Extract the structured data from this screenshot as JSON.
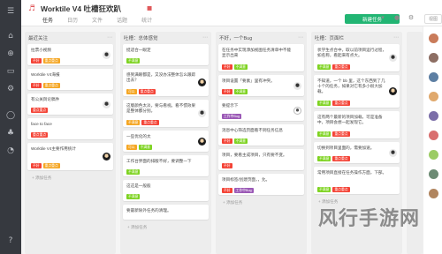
{
  "app": {
    "title": "Worktile V4 吐槽狂欢趴",
    "tabs": [
      "任务",
      "日历",
      "文件",
      "话题",
      "统计"
    ],
    "add_task_label": "新建任务",
    "more_label": "视图"
  },
  "rail_icons": [
    "menu-icon",
    "home-icon",
    "add-icon",
    "inbox-icon",
    "gear-icon",
    "chat-icon",
    "team-icon",
    "bell-icon",
    "help-icon"
  ],
  "tag_colors": {
    "red": "#f44336",
    "yellow": "#f5a623",
    "green": "#7ed321",
    "blue": "#4a90e2",
    "purple": "#9b59b6"
  },
  "columns": [
    {
      "title": "最近关注",
      "add_label": "+ 添加任务",
      "cards": [
        {
          "text": "拉票小视频",
          "tags": [
            {
              "label": "不好",
              "color": "red"
            },
            {
              "label": "重点重点",
              "color": "yellow"
            }
          ],
          "avatar": "a1"
        },
        {
          "text": "Worktile V4海报",
          "tags": [
            {
              "label": "不好",
              "color": "red"
            },
            {
              "label": "重点重点",
              "color": "yellow"
            }
          ],
          "avatar": ""
        },
        {
          "text": "有公关舆论稿件",
          "tags": [
            {
              "label": "重点重点",
              "color": "red"
            }
          ],
          "avatar": "a1"
        },
        {
          "text": "face to face",
          "tags": [
            {
              "label": "重点重点",
              "color": "red"
            }
          ],
          "avatar": ""
        },
        {
          "text": "Worktile V4主要作用统计",
          "tags": [
            {
              "label": "不好",
              "color": "red"
            },
            {
              "label": "重点重点",
              "color": "yellow"
            }
          ],
          "avatar": "a2"
        }
      ]
    },
    {
      "title": "吐槽：总体感觉",
      "add_label": "+ 添加任务",
      "cards": [
        {
          "text": "挺适合一眼定",
          "tags": [
            {
              "label": "不满意",
              "color": "green"
            }
          ],
          "avatar": ""
        },
        {
          "text": "感到满眼都是，又没办法整体怎么跟踪出去？",
          "tags": [
            {
              "label": "可以",
              "color": "yellow"
            },
            {
              "label": "重点重点",
              "color": "red"
            }
          ],
          "avatar": "a2"
        },
        {
          "text": "这版颜色太淡，要与看视。看不惯效果是整体都分别。",
          "tags": [
            {
              "label": "不满意",
              "color": "yellow"
            },
            {
              "label": "重点重点",
              "color": "red"
            }
          ],
          "avatar": "a1"
        },
        {
          "text": "一些优化的太",
          "tags": [
            {
              "label": "可以",
              "color": "yellow"
            },
            {
              "label": "不满意",
              "color": "green"
            }
          ],
          "avatar": "a2"
        },
        {
          "text": "工作台界面的排版不好，要调整一下",
          "tags": [
            {
              "label": "不满意",
              "color": "green"
            }
          ],
          "avatar": ""
        },
        {
          "text": "这这是一般般",
          "tags": [
            {
              "label": "不满意",
              "color": "green"
            }
          ],
          "avatar": ""
        },
        {
          "text": "要最新除外任务的清理。",
          "tags": [],
          "avatar": ""
        }
      ]
    },
    {
      "title": "不好，一个Bug",
      "add_label": "+ 添加任务",
      "cards": [
        {
          "text": "在任务中实现添加视图任务清单中不能显示出来",
          "tags": [
            {
              "label": "不好",
              "color": "red"
            },
            {
              "label": "不满意",
              "color": "green"
            }
          ],
          "avatar": ""
        },
        {
          "text": "项目设置「要素」里有冲突。",
          "tags": [
            {
              "label": "不好",
              "color": "red"
            },
            {
              "label": "不满意",
              "color": "green"
            }
          ],
          "avatar": "a1"
        },
        {
          "text": "要提示下",
          "tags": [
            {
              "label": "工作中Bug",
              "color": "purple"
            }
          ],
          "avatar": "a3"
        },
        {
          "text": "消息中心筛选页面看不到任务信息",
          "tags": [
            {
              "label": "不好",
              "color": "red"
            },
            {
              "label": "不满意",
              "color": "green"
            }
          ],
          "avatar": ""
        },
        {
          "text": "项目，要看主成项目，只有要不变。",
          "tags": [
            {
              "label": "不好",
              "color": "red"
            }
          ],
          "avatar": ""
        },
        {
          "text": "项目标签/创建页面，，允。",
          "tags": [
            {
              "label": "不好",
              "color": "red"
            },
            {
              "label": "工作中Bug",
              "color": "purple"
            }
          ],
          "avatar": ""
        }
      ]
    },
    {
      "title": "吐槽：页面栏",
      "add_label": "+ 添加任务",
      "cards": [
        {
          "text": "状学生点合中，取以前项目运行过程，如名称，看起来有点大。",
          "tags": [
            {
              "label": "不满意",
              "color": "green"
            },
            {
              "label": "重点重点",
              "color": "red"
            }
          ],
          "avatar": "a1"
        },
        {
          "text": "不知道，一个 bb 里，这个东西到了几十个的任务，如果对它有多小很大加载。",
          "tags": [
            {
              "label": "不满意",
              "color": "green"
            },
            {
              "label": "重点重点",
              "color": "red"
            }
          ],
          "avatar": "a2"
        },
        {
          "text": "这有两个最新的项目加载，可是准备中，项目会想一起发现它。",
          "tags": [
            {
              "label": "不满意",
              "color": "green"
            },
            {
              "label": "重点重点",
              "color": "red"
            }
          ],
          "avatar": ""
        },
        {
          "text": "切换到项目里面的，需要加速。",
          "tags": [
            {
              "label": "不满意",
              "color": "green"
            },
            {
              "label": "重点重点",
              "color": "red"
            }
          ],
          "avatar": "a1"
        },
        {
          "text": "常用项目直接在任务操作方面，下部。",
          "tags": [
            {
              "label": "不满意",
              "color": "green"
            },
            {
              "label": "重点重点",
              "color": "red"
            }
          ],
          "avatar": ""
        }
      ]
    }
  ],
  "member_colors": [
    "#c97b5a",
    "#8d6e63",
    "#5d7fa3",
    "#e0a96d",
    "#7b6ea8",
    "#d96f6f",
    "#9ccc65",
    "#6d8b74",
    "#b0855f"
  ],
  "watermark": "风行手游网"
}
